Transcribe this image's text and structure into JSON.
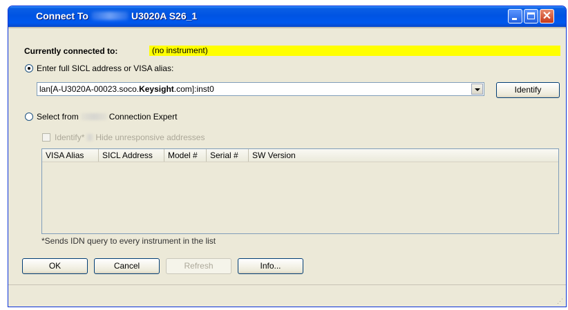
{
  "window": {
    "title_prefix": "Connect To",
    "title_suffix": "U3020A S26_1"
  },
  "status": {
    "label": "Currently connected to:",
    "value": "(no instrument)",
    "highlight_color": "#ffff00"
  },
  "option_visa": {
    "label": "Enter full SICL address or VISA alias:",
    "selected": true
  },
  "address": {
    "value_prefix": "lan[A-U3020A-00023.soco.",
    "value_bold": "Keysight",
    "value_suffix": ".com]:inst0"
  },
  "buttons": {
    "identify": "Identify",
    "ok": "OK",
    "cancel": "Cancel",
    "refresh": "Refresh",
    "info": "Info..."
  },
  "option_expert": {
    "label_prefix": "Select from",
    "label_suffix": "Connection Expert",
    "selected": false
  },
  "identify_check": {
    "label_prefix": "Identify*",
    "label_suffix": "Hide unresponsive addresses",
    "checked": false,
    "enabled": false
  },
  "table": {
    "columns": [
      "VISA Alias",
      "SICL Address",
      "Model #",
      "Serial #",
      "SW Version"
    ],
    "rows": []
  },
  "footnote": "*Sends IDN query to every instrument in the list",
  "colors": {
    "titlebar": "#0054e3",
    "window_bg": "#ece9d8",
    "close_button": "#c7391a"
  }
}
